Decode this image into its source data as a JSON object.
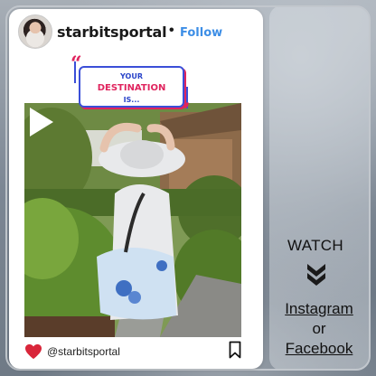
{
  "post": {
    "username": "starbitsportal",
    "separator": "•",
    "follow_label": "Follow",
    "footer_handle": "@starbitsportal"
  },
  "overlay": {
    "line1": "YOUR",
    "line2": "DESTINATION",
    "line3": "IS..."
  },
  "side": {
    "watch_label": "WATCH",
    "instagram_label": "Instagram",
    "or_label": "or",
    "facebook_label": "Facebook"
  },
  "icons": {
    "heart": "heart-icon",
    "bookmark": "bookmark-icon",
    "next": "play-arrow-icon",
    "chevrons": "double-chevron-down-icon"
  },
  "colors": {
    "follow": "#3d8ee6",
    "accent_pink": "#e0245e",
    "accent_blue": "#3b4fd8",
    "heart": "#d9263a"
  }
}
